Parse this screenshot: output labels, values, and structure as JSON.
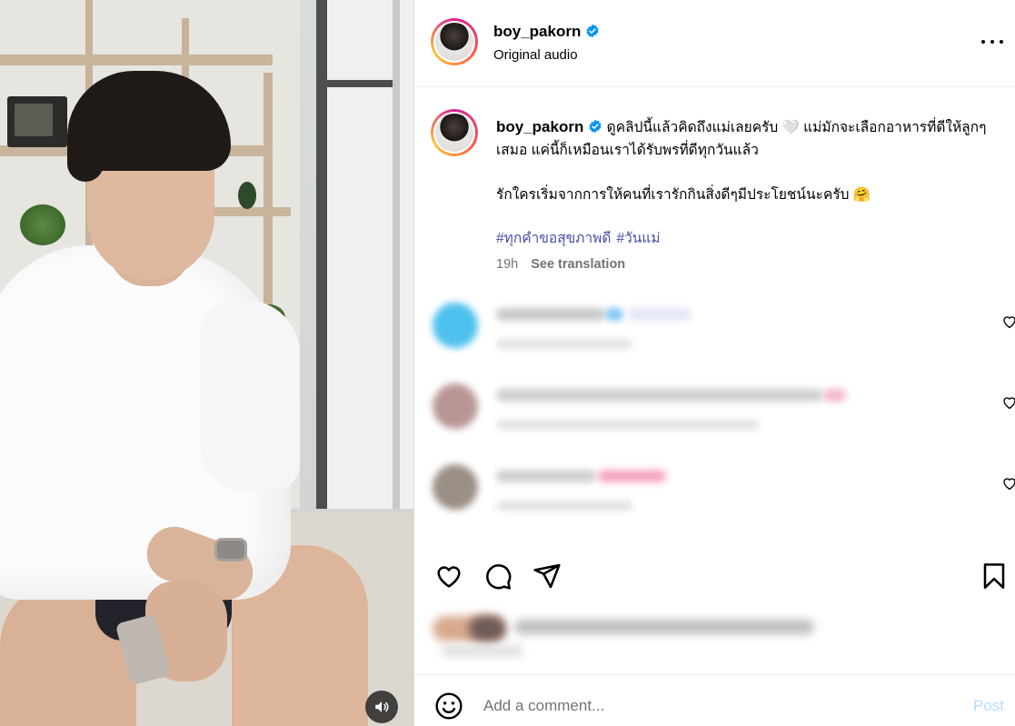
{
  "post": {
    "username": "boy_pakorn",
    "audio": "Original audio",
    "caption_line1": "ดูคลิปนี้แล้วคิดถึงแม่เลยครับ 🤍 แม่มักจะเลือกอาหารที่ดีให้ลูกๆเสมอ แค่นี้ก็เหมือนเราได้รับพรที่ดีทุกวันแล้ว",
    "caption_line2": "รักใครเริ่มจากการให้คนที่เรารักกินสิ่งดีๆมีประโยชน์นะครับ 🤗",
    "hashtags": [
      "#ทุกคำขอสุขภาพดี",
      "#วันแม่"
    ],
    "time": "19h",
    "see_translation": "See translation"
  },
  "comment_box": {
    "placeholder": "Add a comment...",
    "post_label": "Post"
  },
  "icons": {
    "verified": "verified-badge-icon",
    "more": "more-options-icon",
    "like": "heart-icon",
    "comment": "comment-icon",
    "share": "send-icon",
    "save": "bookmark-icon",
    "emoji": "emoji-icon",
    "audio": "speaker-icon"
  },
  "colors": {
    "link": "#4750a8",
    "verified": "#0095f6",
    "muted": "#737373",
    "post_disabled": "#b3dbff"
  }
}
